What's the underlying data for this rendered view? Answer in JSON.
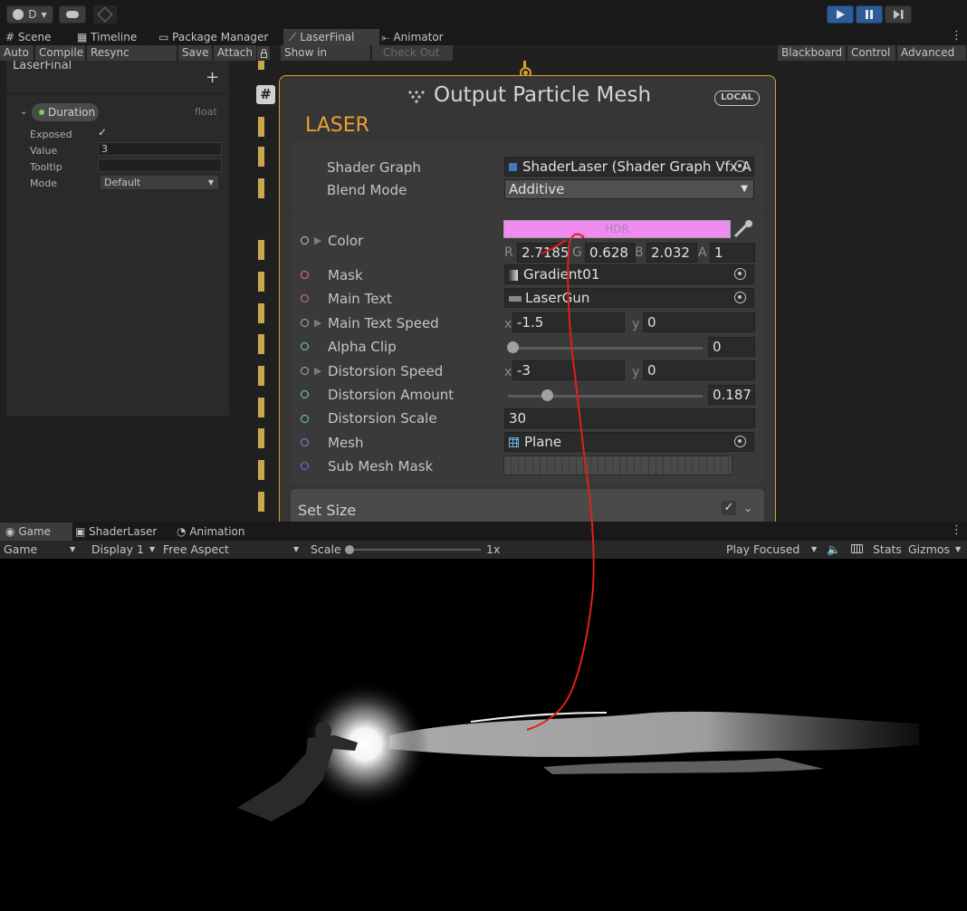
{
  "toolbar": {
    "account_label": "D",
    "play_controls": [
      "play-icon",
      "pause-icon",
      "step-icon"
    ]
  },
  "tabs": [
    {
      "label": "Scene",
      "icon": "grid-icon"
    },
    {
      "label": "Timeline",
      "icon": "film-icon"
    },
    {
      "label": "Package Manager",
      "icon": "package-icon"
    },
    {
      "label": "LaserFinal",
      "icon": "vfx-icon"
    },
    {
      "label": "Animator",
      "icon": "animator-icon"
    }
  ],
  "vfx_toolbar": {
    "left": [
      "Auto",
      "Compile",
      "Resync Material",
      "Save",
      "Attach"
    ],
    "show_in_project": "Show in Project",
    "check_out": "Check Out",
    "right": [
      "Blackboard",
      "Control",
      "Advanced"
    ]
  },
  "blackboard": {
    "title": "LaserFinal",
    "add": "+",
    "property": {
      "name": "Duration",
      "type": "float",
      "fields": [
        {
          "label": "Exposed",
          "value": "✓"
        },
        {
          "label": "Value",
          "value": "3"
        },
        {
          "label": "Tooltip",
          "value": ""
        },
        {
          "label": "Mode",
          "value": "Default"
        }
      ]
    }
  },
  "node": {
    "badge": "#",
    "title": "Output Particle Mesh",
    "space": "LOCAL",
    "subtitle": "LASER",
    "settings": [
      {
        "label": "Shader Graph",
        "value": "ShaderLaser (Shader Graph Vfx A"
      },
      {
        "label": "Blend Mode",
        "value": "Additive"
      }
    ],
    "color": {
      "label": "Color",
      "hdr": "HDR",
      "swatch": "#f08cf0",
      "r": "2.7185",
      "g": "0.628",
      "b": "2.032",
      "a": "1"
    },
    "inputs": [
      {
        "label": "Mask",
        "value": "Gradient01",
        "port": "#e27a7a"
      },
      {
        "label": "Main Text",
        "value": "LaserGun",
        "port": "#e27a7a"
      },
      {
        "label": "Main Text Speed",
        "x": "-1.5",
        "y": "0",
        "port": "#8cd07a"
      },
      {
        "label": "Alpha Clip",
        "value": "0",
        "slider": 0.0,
        "port": "#7acfcf"
      },
      {
        "label": "Distorsion Speed",
        "x": "-3",
        "y": "0",
        "port": "#8cd07a"
      },
      {
        "label": "Distorsion Amount",
        "value": "0.187",
        "slider": 0.187,
        "port": "#7acfcf"
      },
      {
        "label": "Distorsion Scale",
        "value": "30",
        "port": "#7acfcf"
      },
      {
        "label": "Mesh",
        "value": "Plane",
        "port": "#8a8ae0"
      },
      {
        "label": "Sub Mesh Mask",
        "value": "",
        "port": "#8a6ae0"
      }
    ],
    "x_label": "x",
    "y_label": "y",
    "block": {
      "label": "Set Size"
    }
  },
  "game_tabs": [
    {
      "label": "Game",
      "icon": "gamepad-icon"
    },
    {
      "label": "ShaderLaser",
      "icon": "shader-icon"
    },
    {
      "label": "Animation",
      "icon": "clock-icon"
    }
  ],
  "game_bar": {
    "view": "Game",
    "display": "Display 1",
    "aspect": "Free Aspect",
    "scale_label": "Scale",
    "scale_value": "1x",
    "play_mode": "Play Focused",
    "stats": "Stats",
    "gizmos": "Gizmos"
  },
  "colors": {
    "accent_orange": "#d9a22a",
    "annotation_red": "#e0201c",
    "play_blue": "#2d5c98"
  }
}
